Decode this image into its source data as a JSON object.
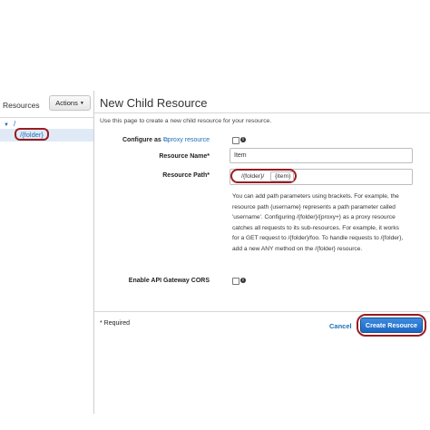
{
  "sidebar": {
    "title": "Resources",
    "actions_label": "Actions",
    "tree_root": "/",
    "tree_child": "/{folder}"
  },
  "main": {
    "title": "New Child Resource",
    "intro": "Use this page to create a new child resource for your resource.",
    "configure_label": "Configure as",
    "configure_link": "proxy resource",
    "resource_name_label": "Resource Name*",
    "resource_name_value": "Item",
    "resource_path_label": "Resource Path*",
    "resource_path_prefix": "/{folder}/",
    "resource_path_value": "{item}",
    "help_lines": [
      "You can add path parameters using brackets. For example, the",
      "resource path {username} represents a path parameter called",
      "'username'. Configuring /{folder}/{proxy+} as a proxy resource",
      "catches all requests to its sub-resources. For example, it works",
      "for a GET request to /{folder}/foo. To handle requests to /{folder},",
      "add a new ANY method on the /{folder} resource."
    ],
    "cors_label": "Enable API Gateway CORS"
  },
  "footer": {
    "required_note": "* Required",
    "cancel_label": "Cancel",
    "create_label": "Create Resource"
  },
  "colors": {
    "link": "#1f6fb5",
    "primary_button": "#2a7ad6",
    "highlight_ring": "#9b1c22"
  }
}
